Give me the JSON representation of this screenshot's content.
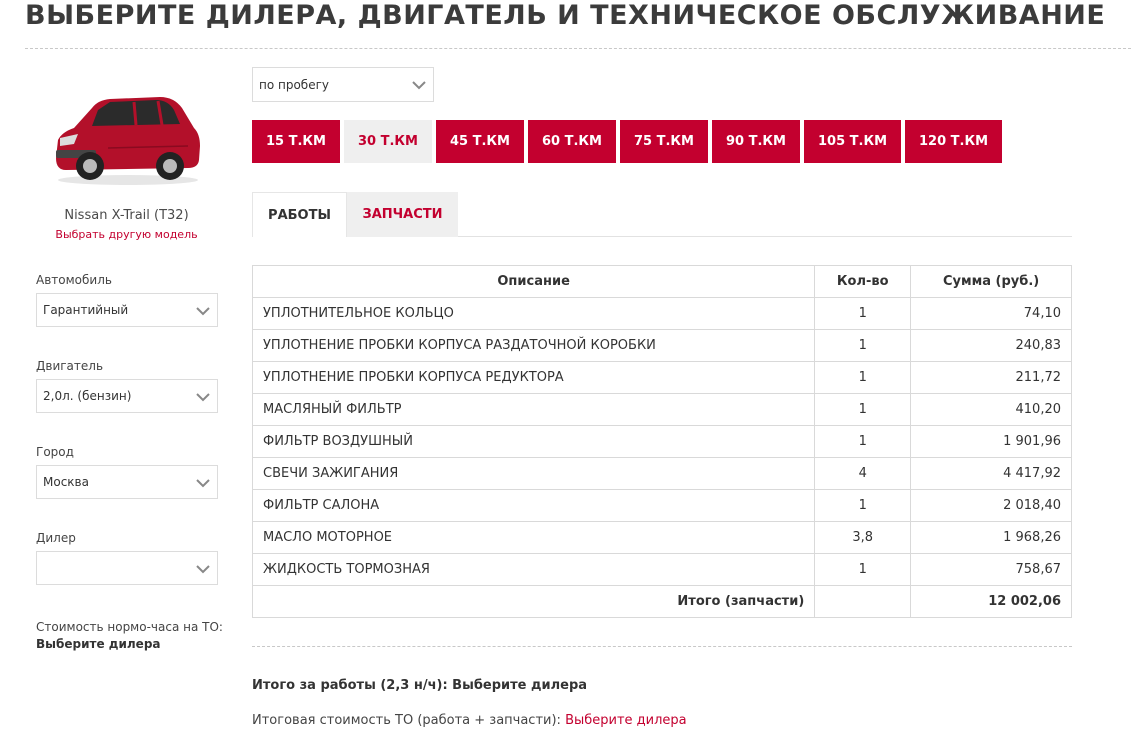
{
  "page": {
    "title": "ВЫБЕРИТЕ ДИЛЕРА, ДВИГАТЕЛЬ И ТЕХНИЧЕСКОЕ ОБСЛУЖИВАНИЕ"
  },
  "car": {
    "model": "Nissan X-Trail (T32)",
    "change_link": "Выбрать другую модель"
  },
  "filters": {
    "car_label": "Автомобиль",
    "car_value": "Гарантийный",
    "engine_label": "Двигатель",
    "engine_value": "2,0л. (бензин)",
    "city_label": "Город",
    "city_value": "Москва",
    "dealer_label": "Дилер",
    "dealer_value": "",
    "rate_label": "Стоимость нормо-часа на ТО:",
    "rate_value": "Выберите дилера"
  },
  "mileage": {
    "select_value": "по пробегу",
    "buttons": [
      "15 Т.КМ",
      "30 Т.КМ",
      "45 Т.КМ",
      "60 Т.КМ",
      "75 Т.КМ",
      "90 Т.КМ",
      "105 Т.КМ",
      "120 Т.КМ"
    ],
    "active": "30 Т.КМ"
  },
  "tabs": {
    "works": "РАБОТЫ",
    "parts": "ЗАПЧАСТИ"
  },
  "table": {
    "headers": {
      "description": "Описание",
      "qty": "Кол-во",
      "sum": "Сумма (руб.)"
    },
    "rows": [
      {
        "description": "УПЛОТНИТЕЛЬНОЕ КОЛЬЦО",
        "qty": "1",
        "sum": "74,10"
      },
      {
        "description": "УПЛОТНЕНИЕ ПРОБКИ КОРПУСА РАЗДАТОЧНОЙ КОРОБКИ",
        "qty": "1",
        "sum": "240,83"
      },
      {
        "description": "УПЛОТНЕНИЕ ПРОБКИ КОРПУСА РЕДУКТОРА",
        "qty": "1",
        "sum": "211,72"
      },
      {
        "description": "МАСЛЯНЫЙ ФИЛЬТР",
        "qty": "1",
        "sum": "410,20"
      },
      {
        "description": "ФИЛЬТР ВОЗДУШНЫЙ",
        "qty": "1",
        "sum": "1 901,96"
      },
      {
        "description": "СВЕЧИ ЗАЖИГАНИЯ",
        "qty": "4",
        "sum": "4 417,92"
      },
      {
        "description": "ФИЛЬТР САЛОНА",
        "qty": "1",
        "sum": "2 018,40"
      },
      {
        "description": "МАСЛО МОТОРНОЕ",
        "qty": "3,8",
        "sum": "1 968,26"
      },
      {
        "description": "ЖИДКОСТЬ ТОРМОЗНАЯ",
        "qty": "1",
        "sum": "758,67"
      }
    ],
    "total_label": "Итого (запчасти)",
    "total_value": "12 002,06"
  },
  "summary": {
    "works_total": "Итого за работы (2,3 н/ч): Выберите дилера",
    "grand_total_label": "Итоговая стоимость ТО (работа + запчасти):",
    "grand_total_link": "Выберите дилера"
  },
  "colors": {
    "accent": "#c3002f",
    "active_tab_bg": "#efefef",
    "car_body": "#b3102a"
  }
}
